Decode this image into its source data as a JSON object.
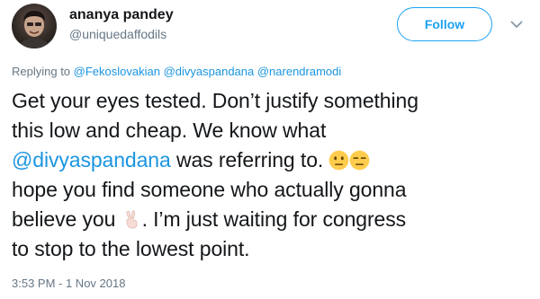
{
  "author": {
    "display_name": "ananya pandey",
    "handle": "@uniquedaffodils"
  },
  "follow_button": {
    "label": "Follow"
  },
  "menu": {
    "icon": "chevron-down-icon"
  },
  "reply_context": {
    "prefix": "Replying to ",
    "mentions": [
      "@Fekoslovakian",
      "@divyaspandana",
      "@narendramodi"
    ]
  },
  "tweet": {
    "line1": "Get your eyes tested. Don’t justify something",
    "line2": "this low and cheap. We know what",
    "line3_mention": "@divyaspandana",
    "line3_text": " was referring to. ",
    "line4": "hope you find someone who actually gonna",
    "line5": "believe you ",
    "line5_after": ". I’m just waiting for congress",
    "line6": "to stop to the lowest point.",
    "emojis": [
      "neutral-face-icon",
      "expressionless-face-icon",
      "victory-hand-icon"
    ]
  },
  "timestamp": "3:53 PM - 1 Nov 2018",
  "colors": {
    "accent": "#1da1f2",
    "mention": "#1b95e0",
    "secondary_text": "#657786",
    "emoji_yellow": "#ffcc4d"
  }
}
